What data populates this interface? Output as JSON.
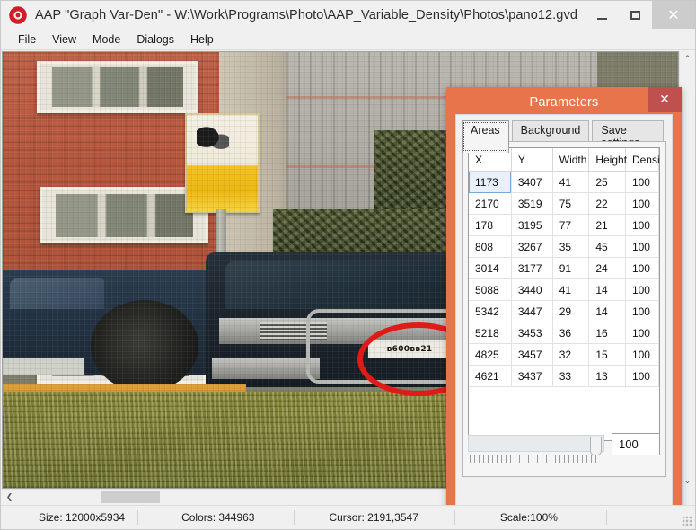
{
  "window": {
    "title": "AAP \"Graph Var-Den\" - W:\\Work\\Programs\\Photo\\AAP_Variable_Density\\Photos\\pano12.gvd",
    "app_icon": "aap-logo-icon",
    "controls": {
      "minimize": "minimize-icon",
      "maximize": "maximize-icon",
      "close": "✕"
    }
  },
  "menubar": {
    "items": [
      {
        "label": "File"
      },
      {
        "label": "View"
      },
      {
        "label": "Mode"
      },
      {
        "label": "Dialogs"
      },
      {
        "label": "Help"
      }
    ]
  },
  "canvas": {
    "annotation": {
      "type": "ellipse",
      "color": "#e01b17"
    },
    "license_plate": "в600вв21"
  },
  "scrollbars": {
    "vertical": {
      "up_arrow": "⌃",
      "down_arrow": "⌄"
    },
    "horizontal": {
      "left_arrow": "❮",
      "right_arrow": "❯"
    }
  },
  "statusbar": {
    "cells": [
      {
        "label": "Size: 12000x5934"
      },
      {
        "label": "Colors: 344963"
      },
      {
        "label": "Cursor: 2191,3547"
      },
      {
        "label": "Scale:100%"
      }
    ]
  },
  "dialog": {
    "title": "Parameters",
    "close_label": "✕",
    "accent_color": "#e8744b",
    "close_bg": "#c0504d",
    "tabs": [
      {
        "label": "Areas",
        "active": true
      },
      {
        "label": "Background",
        "active": false
      },
      {
        "label": "Save settings",
        "active": false
      }
    ],
    "grid": {
      "columns": [
        "X",
        "Y",
        "Width",
        "Height",
        "Density"
      ],
      "selected_row": 0,
      "selected_col": 0,
      "rows": [
        [
          "1173",
          "3407",
          "41",
          "25",
          "100"
        ],
        [
          "2170",
          "3519",
          "75",
          "22",
          "100"
        ],
        [
          "178",
          "3195",
          "77",
          "21",
          "100"
        ],
        [
          "808",
          "3267",
          "35",
          "45",
          "100"
        ],
        [
          "3014",
          "3177",
          "91",
          "24",
          "100"
        ],
        [
          "5088",
          "3440",
          "41",
          "14",
          "100"
        ],
        [
          "5342",
          "3447",
          "29",
          "14",
          "100"
        ],
        [
          "5218",
          "3453",
          "36",
          "16",
          "100"
        ],
        [
          "4825",
          "3457",
          "32",
          "15",
          "100"
        ],
        [
          "4621",
          "3437",
          "33",
          "13",
          "100"
        ]
      ]
    },
    "slider": {
      "value": "100",
      "min": 0,
      "max": 100
    }
  }
}
